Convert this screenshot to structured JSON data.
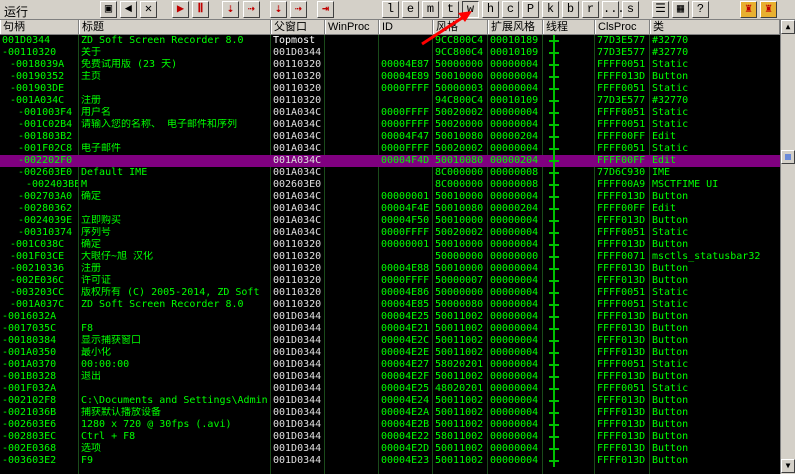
{
  "toolbar": {
    "menu_label": "运行",
    "letter_buttons": [
      "l",
      "e",
      "m",
      "t",
      "w",
      "h",
      "c",
      "P",
      "k",
      "b",
      "r",
      "...",
      "s"
    ],
    "selected_letter": "w",
    "icons": [
      "open-icon",
      "left-arrow-icon",
      "close-x-icon",
      "run-icon",
      "pause-icon",
      "step-into-icon",
      "step-over-icon",
      "trace-into-icon",
      "trace-over-icon",
      "execute-till-return-icon",
      "list-icon",
      "grid-icon",
      "help-icon",
      "plugin1-icon",
      "plugin2-icon"
    ]
  },
  "columns": [
    "句柄",
    "标题",
    "父窗口",
    "WinProc",
    "ID",
    "风格",
    "扩展风格",
    "线程",
    "ClsProc",
    "类"
  ],
  "rows": [
    {
      "handle": "001D0344",
      "depth": 0,
      "title": "ZD Soft Screen Recorder 8.0",
      "parent": "Topmost",
      "winproc": "",
      "id": "",
      "style": "9CC800C4",
      "exstyle": "00010189",
      "clsproc": "77D3E577",
      "class": "#32770"
    },
    {
      "handle": "-00110320",
      "depth": 0,
      "title": "关于",
      "parent": "001D0344",
      "winproc": "",
      "id": "",
      "style": "9CC800C4",
      "exstyle": "00010109",
      "clsproc": "77D3E577",
      "class": "#32770"
    },
    {
      "handle": "-0018039A",
      "depth": 1,
      "title": "免费试用版 (23 天)",
      "parent": "00110320",
      "winproc": "",
      "id": "00004E87",
      "style": "50000000",
      "exstyle": "00000004",
      "clsproc": "FFFF0051",
      "class": "Static"
    },
    {
      "handle": "-00190352",
      "depth": 1,
      "title": "主页",
      "parent": "00110320",
      "winproc": "",
      "id": "00004E89",
      "style": "50010000",
      "exstyle": "00000004",
      "clsproc": "FFFF013D",
      "class": "Button"
    },
    {
      "handle": "-001903DE",
      "depth": 1,
      "title": "",
      "parent": "00110320",
      "winproc": "",
      "id": "0000FFFF",
      "style": "50000003",
      "exstyle": "00000004",
      "clsproc": "FFFF0051",
      "class": "Static"
    },
    {
      "handle": "-001A034C",
      "depth": 1,
      "title": "注册",
      "parent": "00110320",
      "winproc": "",
      "id": "",
      "style": "94C800C4",
      "exstyle": "00010109",
      "clsproc": "77D3E577",
      "class": "#32770"
    },
    {
      "handle": "-001003F4",
      "depth": 2,
      "title": "用户名",
      "parent": "001A034C",
      "winproc": "",
      "id": "0000FFFF",
      "style": "50020002",
      "exstyle": "00000004",
      "clsproc": "FFFF0051",
      "class": "Static"
    },
    {
      "handle": "-001C02B4",
      "depth": 2,
      "title": "请输入您的名称、 电子邮件和序列",
      "parent": "001A034C",
      "winproc": "",
      "id": "0000FFFF",
      "style": "50020000",
      "exstyle": "00000004",
      "clsproc": "FFFF0051",
      "class": "Static"
    },
    {
      "handle": "-001803B2",
      "depth": 2,
      "title": "",
      "parent": "001A034C",
      "winproc": "",
      "id": "00004F47",
      "style": "50010080",
      "exstyle": "00000204",
      "clsproc": "FFFF00FF",
      "class": "Edit"
    },
    {
      "handle": "-001F02C8",
      "depth": 2,
      "title": "电子邮件",
      "parent": "001A034C",
      "winproc": "",
      "id": "0000FFFF",
      "style": "50020002",
      "exstyle": "00000004",
      "clsproc": "FFFF0051",
      "class": "Static"
    },
    {
      "handle": "-002202F0",
      "depth": 2,
      "title": "",
      "parent": "001A034C",
      "winproc": "",
      "id": "00004F4D",
      "style": "50010080",
      "exstyle": "00000204",
      "clsproc": "FFFF00FF",
      "class": "Edit",
      "selected": true
    },
    {
      "handle": "-002603E0",
      "depth": 2,
      "title": "Default IME",
      "parent": "001A034C",
      "winproc": "",
      "id": "",
      "style": "8C000000",
      "exstyle": "00000008",
      "clsproc": "77D6C930",
      "class": "IME"
    },
    {
      "handle": "-002403BE",
      "depth": 3,
      "title": "M",
      "parent": "002603E0",
      "winproc": "",
      "id": "",
      "style": "8C000000",
      "exstyle": "00000008",
      "clsproc": "FFFF00A9",
      "class": "MSCTFIME UI"
    },
    {
      "handle": "-002703A0",
      "depth": 2,
      "title": "确定",
      "parent": "001A034C",
      "winproc": "",
      "id": "00000001",
      "style": "50010000",
      "exstyle": "00000004",
      "clsproc": "FFFF013D",
      "class": "Button"
    },
    {
      "handle": "-00280362",
      "depth": 2,
      "title": "",
      "parent": "001A034C",
      "winproc": "",
      "id": "00004F4E",
      "style": "50010080",
      "exstyle": "00000204",
      "clsproc": "FFFF00FF",
      "class": "Edit"
    },
    {
      "handle": "-0024039E",
      "depth": 2,
      "title": "立即购买",
      "parent": "001A034C",
      "winproc": "",
      "id": "00004F50",
      "style": "50010000",
      "exstyle": "00000004",
      "clsproc": "FFFF013D",
      "class": "Button"
    },
    {
      "handle": "-00310374",
      "depth": 2,
      "title": "序列号",
      "parent": "001A034C",
      "winproc": "",
      "id": "0000FFFF",
      "style": "50020002",
      "exstyle": "00000004",
      "clsproc": "FFFF0051",
      "class": "Static"
    },
    {
      "handle": "-001C038C",
      "depth": 1,
      "title": "确定",
      "parent": "00110320",
      "winproc": "",
      "id": "00000001",
      "style": "50010000",
      "exstyle": "00000004",
      "clsproc": "FFFF013D",
      "class": "Button"
    },
    {
      "handle": "-001F03CE",
      "depth": 1,
      "title": "                  大眼仔~旭 汉化",
      "parent": "00110320",
      "winproc": "",
      "id": "",
      "style": "50000000",
      "exstyle": "00000000",
      "clsproc": "FFFF0071",
      "class": "msctls_statusbar32"
    },
    {
      "handle": "-00210336",
      "depth": 1,
      "title": "注册",
      "parent": "00110320",
      "winproc": "",
      "id": "00004E88",
      "style": "50010000",
      "exstyle": "00000004",
      "clsproc": "FFFF013D",
      "class": "Button"
    },
    {
      "handle": "-002E036C",
      "depth": 1,
      "title": "许可证",
      "parent": "00110320",
      "winproc": "",
      "id": "0000FFFF",
      "style": "50000007",
      "exstyle": "00000004",
      "clsproc": "FFFF013D",
      "class": "Button"
    },
    {
      "handle": "-003203CC",
      "depth": 1,
      "title": "版权所有 (C) 2005-2014, ZD Soft",
      "parent": "00110320",
      "winproc": "",
      "id": "00004E86",
      "style": "50000000",
      "exstyle": "00000004",
      "clsproc": "FFFF0051",
      "class": "Static"
    },
    {
      "handle": "-001A037C",
      "depth": 1,
      "title": "ZD Soft Screen Recorder 8.0",
      "parent": "00110320",
      "winproc": "",
      "id": "00004E85",
      "style": "50000080",
      "exstyle": "00000004",
      "clsproc": "FFFF0051",
      "class": "Static"
    },
    {
      "handle": "-0016032A",
      "depth": 0,
      "title": "",
      "parent": "001D0344",
      "winproc": "",
      "id": "00004E25",
      "style": "50011002",
      "exstyle": "00000004",
      "clsproc": "FFFF013D",
      "class": "Button"
    },
    {
      "handle": "-0017035C",
      "depth": 0,
      "title": "F8",
      "parent": "001D0344",
      "winproc": "",
      "id": "00004E21",
      "style": "50011002",
      "exstyle": "00000004",
      "clsproc": "FFFF013D",
      "class": "Button"
    },
    {
      "handle": "-00180384",
      "depth": 0,
      "title": "显示捕获窗口",
      "parent": "001D0344",
      "winproc": "",
      "id": "00004E2C",
      "style": "50011002",
      "exstyle": "00000004",
      "clsproc": "FFFF013D",
      "class": "Button"
    },
    {
      "handle": "-001A0350",
      "depth": 0,
      "title": "最小化",
      "parent": "001D0344",
      "winproc": "",
      "id": "00004E2E",
      "style": "50011002",
      "exstyle": "00000004",
      "clsproc": "FFFF013D",
      "class": "Button"
    },
    {
      "handle": "-001A0370",
      "depth": 0,
      "title": "00:00:00",
      "parent": "001D0344",
      "winproc": "",
      "id": "00004E27",
      "style": "58020201",
      "exstyle": "00000004",
      "clsproc": "FFFF0051",
      "class": "Static"
    },
    {
      "handle": "-001B0328",
      "depth": 0,
      "title": "退出",
      "parent": "001D0344",
      "winproc": "",
      "id": "00004E2F",
      "style": "50011002",
      "exstyle": "00000004",
      "clsproc": "FFFF013D",
      "class": "Button"
    },
    {
      "handle": "-001F032A",
      "depth": 0,
      "title": "",
      "parent": "001D0344",
      "winproc": "",
      "id": "00004E25",
      "style": "48020201",
      "exstyle": "00000004",
      "clsproc": "FFFF0051",
      "class": "Static"
    },
    {
      "handle": "-002102F8",
      "depth": 0,
      "title": "C:\\Documents and Settings\\Admin",
      "parent": "001D0344",
      "winproc": "",
      "id": "00004E24",
      "style": "50011002",
      "exstyle": "00000004",
      "clsproc": "FFFF013D",
      "class": "Button"
    },
    {
      "handle": "-0021036B",
      "depth": 0,
      "title": "捕获默认播放设备",
      "parent": "001D0344",
      "winproc": "",
      "id": "00004E2A",
      "style": "50011002",
      "exstyle": "00000004",
      "clsproc": "FFFF013D",
      "class": "Button"
    },
    {
      "handle": "-002603E6",
      "depth": 0,
      "title": "1280 x 720 @ 30fps (.avi)",
      "parent": "001D0344",
      "winproc": "",
      "id": "00004E2B",
      "style": "50011002",
      "exstyle": "00000004",
      "clsproc": "FFFF013D",
      "class": "Button"
    },
    {
      "handle": "-002803EC",
      "depth": 0,
      "title": "Ctrl + F8",
      "parent": "001D0344",
      "winproc": "",
      "id": "00004E22",
      "style": "58011002",
      "exstyle": "00000004",
      "clsproc": "FFFF013D",
      "class": "Button"
    },
    {
      "handle": "-002E0368",
      "depth": 0,
      "title": "选项",
      "parent": "001D0344",
      "winproc": "",
      "id": "00004E2D",
      "style": "50011002",
      "exstyle": "00000004",
      "clsproc": "FFFF013D",
      "class": "Button"
    },
    {
      "handle": "-003603E2",
      "depth": 0,
      "title": "F9",
      "parent": "001D0344",
      "winproc": "",
      "id": "00004E23",
      "style": "50011002",
      "exstyle": "00000004",
      "clsproc": "FFFF013D",
      "class": "Button"
    }
  ],
  "colors": {
    "accent_selected": "#800080",
    "text_green": "#00ff00",
    "toolbar": "#d4d0c8",
    "arrow": "#ff0000"
  }
}
